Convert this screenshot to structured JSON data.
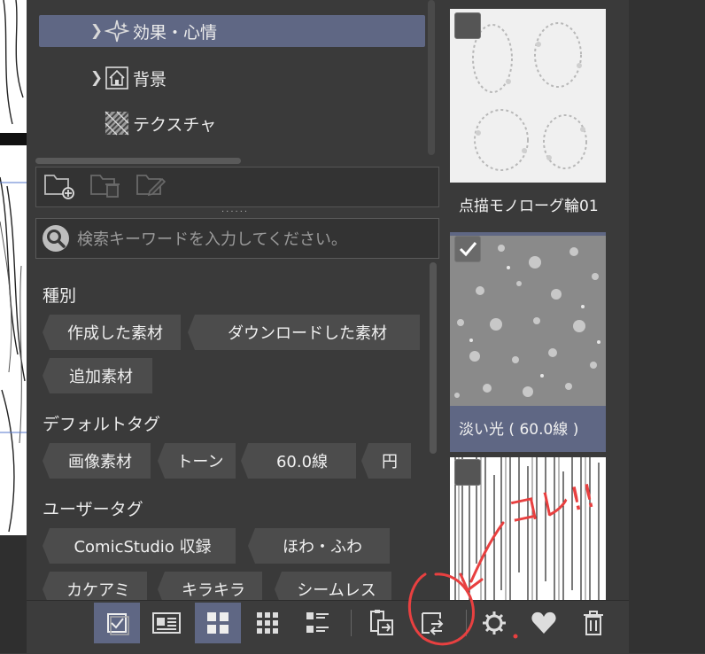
{
  "tree": {
    "items": [
      {
        "label": "効果・心情",
        "icon": "sparkle-icon",
        "selected": true
      },
      {
        "label": "背景",
        "icon": "house-icon",
        "selected": false
      },
      {
        "label": "テクスチャ",
        "icon": "texture-icon",
        "selected": false
      }
    ]
  },
  "search": {
    "placeholder": "検索キーワードを入力してください。"
  },
  "tags": {
    "kind_title": "種別",
    "kind": [
      "作成した素材",
      "ダウンロードした素材",
      "追加素材"
    ],
    "default_title": "デフォルトタグ",
    "default": [
      "画像素材",
      "トーン",
      "60.0線",
      "円"
    ],
    "user_title": "ユーザータグ",
    "user": [
      "ComicStudio 収録",
      "ほわ・ふわ",
      "カケアミ",
      "キラキラ",
      "シームレス"
    ]
  },
  "materials": [
    {
      "caption": "点描モノローグ輪01",
      "checked": false,
      "selected": false
    },
    {
      "caption": "淡い光 ( 60.0線 )",
      "checked": true,
      "selected": true
    },
    {
      "caption": "",
      "checked": false,
      "selected": false
    }
  ],
  "annotation": {
    "text": "コレ!!",
    "color": "#e84040"
  },
  "toolbar": {
    "buttons": [
      "checklist-icon",
      "detail-view-icon",
      "large-grid-icon",
      "small-grid-icon",
      "list-view-icon",
      "paste-to-canvas-icon",
      "replace-icon",
      "settings-icon",
      "favorite-icon",
      "trash-icon"
    ]
  },
  "colors": {
    "accent": "#5f6784",
    "panel": "#3a3a3a"
  }
}
